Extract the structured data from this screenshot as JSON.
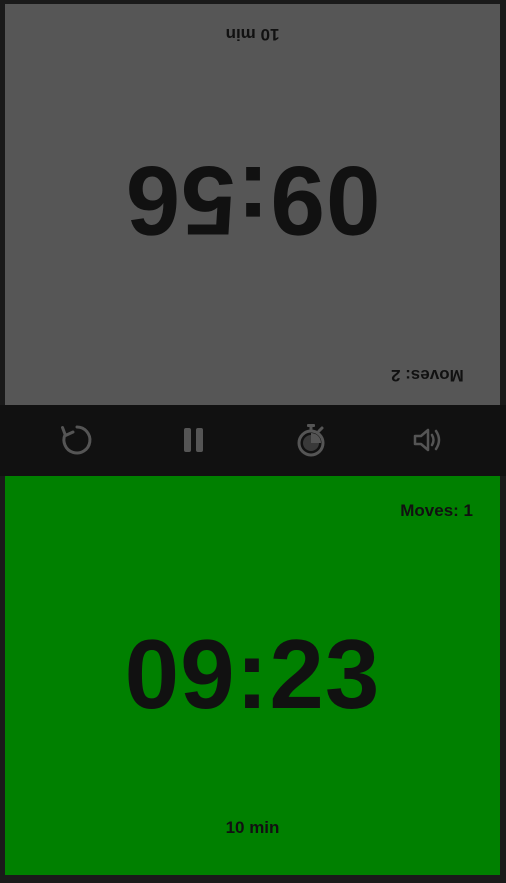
{
  "players": {
    "top": {
      "time": "09:56",
      "moves": "Moves: 2",
      "time_control": "10 min",
      "background": "#565656"
    },
    "bottom": {
      "time": "09:23",
      "moves": "Moves: 1",
      "time_control": "10 min",
      "background": "#008000"
    }
  },
  "toolbar": {
    "buttons": [
      {
        "icon": "restart-icon"
      },
      {
        "icon": "pause-icon"
      },
      {
        "icon": "timer-settings-icon"
      },
      {
        "icon": "volume-icon"
      }
    ],
    "icon_color": "#555555"
  }
}
